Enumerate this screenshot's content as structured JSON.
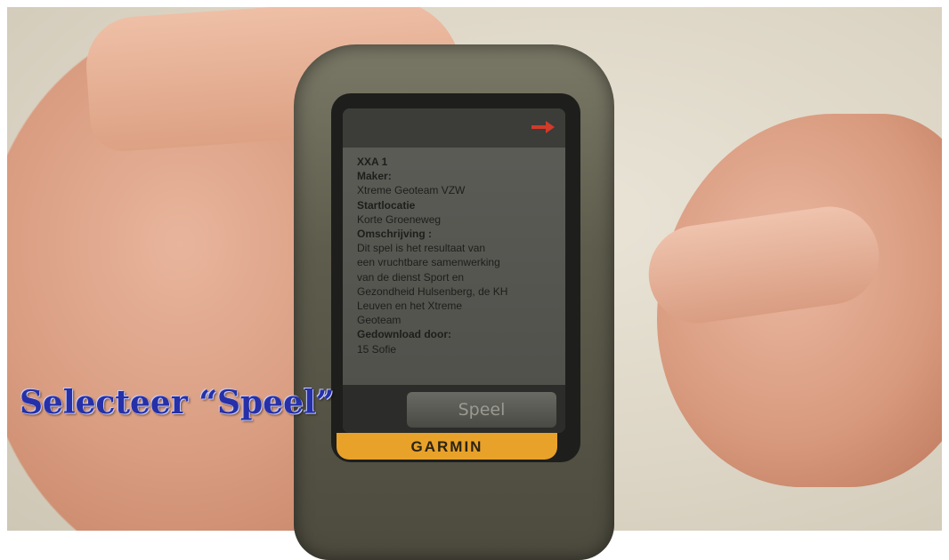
{
  "caption": "Selecteer “Speel”",
  "device": {
    "brand": "GARMIN",
    "header": {
      "clock": "",
      "arrow_icon": "right-arrow-icon"
    },
    "screen_lines": [
      {
        "text": "XXA 1",
        "bold": true
      },
      {
        "text": "Maker:",
        "bold": true
      },
      {
        "text": "Xtreme Geoteam VZW",
        "bold": false
      },
      {
        "text": "Startlocatie",
        "bold": true
      },
      {
        "text": "Korte Groeneweg",
        "bold": false
      },
      {
        "text": "Omschrijving :",
        "bold": true
      },
      {
        "text": "Dit spel is het resultaat van",
        "bold": false
      },
      {
        "text": "een vruchtbare samenwerking",
        "bold": false
      },
      {
        "text": "van de dienst Sport en",
        "bold": false
      },
      {
        "text": "Gezondheid Hulsenberg, de KH",
        "bold": false
      },
      {
        "text": "Leuven en het Xtreme",
        "bold": false
      },
      {
        "text": "Geoteam",
        "bold": false
      },
      {
        "text": "Gedownload door:",
        "bold": true
      },
      {
        "text": "15 Sofie",
        "bold": false
      }
    ],
    "play_button_label": "Speel"
  },
  "colors": {
    "caption": "#2630a8",
    "brand_strip": "#e8a22a",
    "arrow": "#d23a2a"
  }
}
